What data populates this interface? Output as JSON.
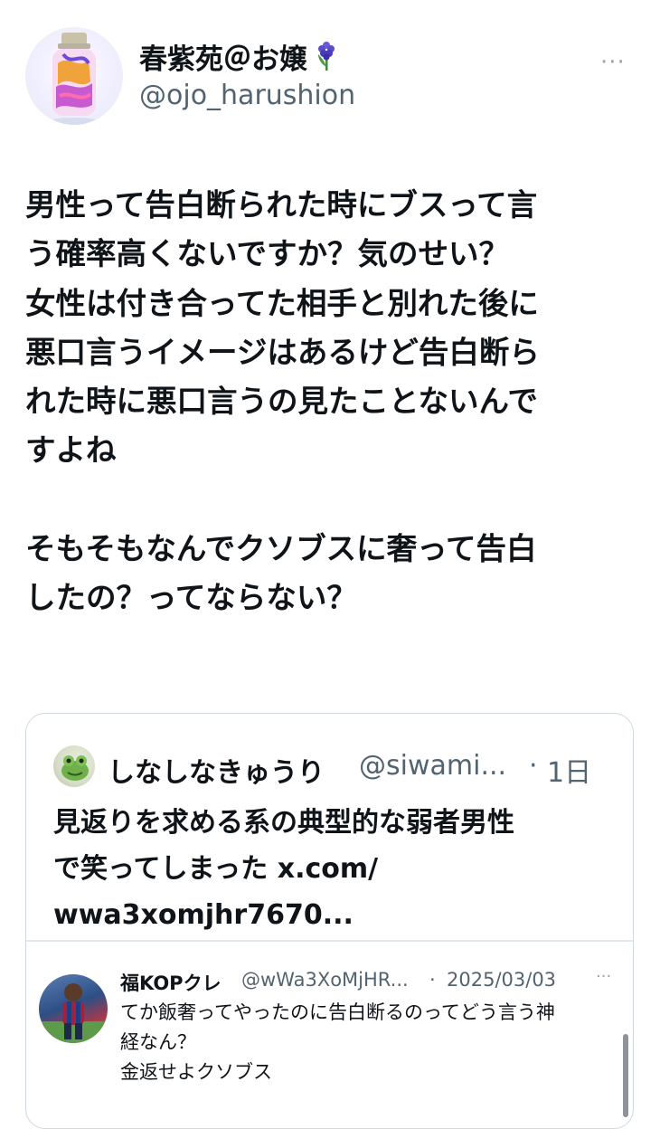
{
  "author": {
    "name": "春紫苑＠お嬢",
    "emoji": "🪻",
    "handle": "@ojo_harushion",
    "avatar_icon": "perfume-bottle-avatar",
    "more_icon": "···"
  },
  "post": {
    "text": "男性って告白断られた時にブスって言\nう確率高くないですか？気のせい？\n女性は付き合ってた相手と別れた後に\n悪口言うイメージはあるけど告白断ら\nれた時に悪口言うの見たことないんで\nすよね\n\nそもそもなんでクソブスに奢って告白\nしたの？ってならない？"
  },
  "quote": {
    "avatar_icon": "frog-avatar",
    "name": "しなしなきゅうり",
    "handle": "@siwami...",
    "separator": "·",
    "time": "1日",
    "text": "見返りを求める系の典型的な弱者男性\nで笑ってしまった x.com/\nwwa3xomjhr7670..."
  },
  "inner_quote": {
    "avatar_icon": "soccer-player-avatar",
    "name": "福KOPクレ",
    "handle": "@wWa3XoMjHR...",
    "separator": "·",
    "date": "2025/03/03",
    "more_icon": "···",
    "text": "てか飯奢ってやったのに告白断るのってどう言う神\n経なん？\n金返せよクソブス"
  },
  "colors": {
    "text": "#0f1419",
    "secondary": "#536471",
    "border": "#cfd9de"
  }
}
